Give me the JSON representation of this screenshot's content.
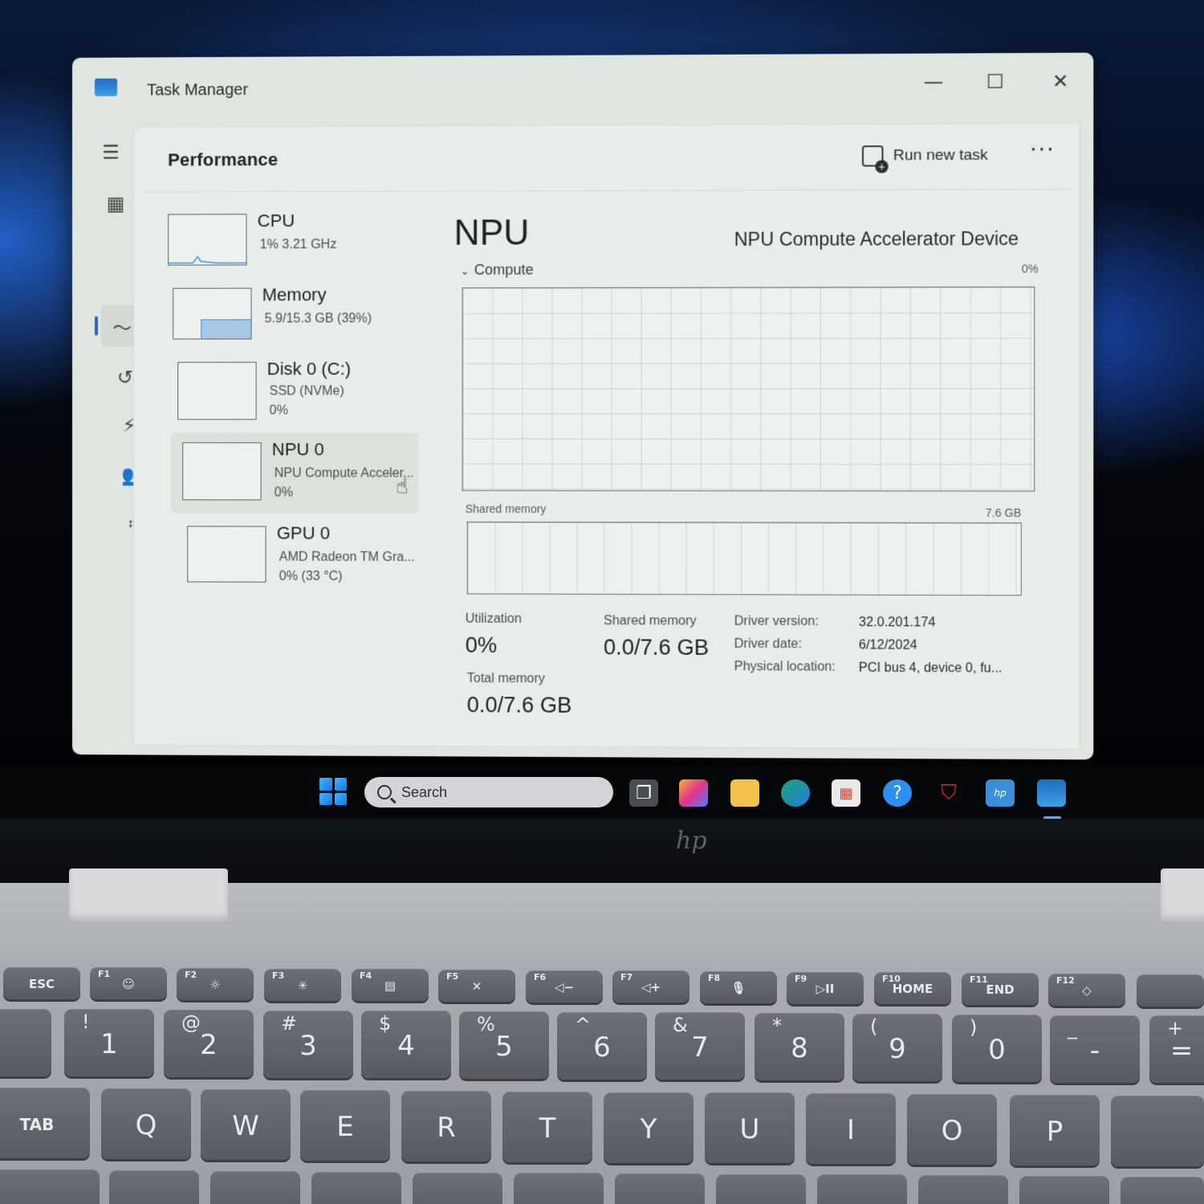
{
  "window": {
    "app_title": "Task Manager",
    "minimize": "—",
    "maximize": "☐",
    "close": "✕"
  },
  "header": {
    "page_title": "Performance",
    "run_new_task": "Run new task",
    "more": "···"
  },
  "nav_rail": {
    "items": [
      {
        "icon": "hamburger-menu-icon",
        "glyph": "☰"
      },
      {
        "icon": "processes-icon",
        "glyph": "▦"
      },
      {
        "icon": "performance-icon",
        "glyph": "〜"
      },
      {
        "icon": "app-history-icon",
        "glyph": "↺"
      },
      {
        "icon": "startup-apps-icon",
        "glyph": "⚡"
      },
      {
        "icon": "users-icon",
        "glyph": "👥"
      },
      {
        "icon": "details-icon",
        "glyph": "≔"
      },
      {
        "icon": "services-icon",
        "glyph": "⚙"
      },
      {
        "icon": "settings-icon",
        "glyph": "⚙"
      }
    ]
  },
  "devices": [
    {
      "name": "CPU",
      "line1": "1%  3.21 GHz",
      "line2": ""
    },
    {
      "name": "Memory",
      "line1": "5.9/15.3 GB (39%)",
      "line2": ""
    },
    {
      "name": "Disk 0 (C:)",
      "line1": "SSD (NVMe)",
      "line2": "0%"
    },
    {
      "name": "NPU 0",
      "line1": "NPU Compute Acceler...",
      "line2": "0%"
    },
    {
      "name": "GPU 0",
      "line1": "AMD Radeon TM Gra...",
      "line2": "0%  (33 °C)"
    }
  ],
  "main": {
    "title": "NPU",
    "device_name": "NPU Compute Accelerator Device",
    "compute_label": "Compute",
    "compute_max": "0%",
    "compute_utilization_percent": 0,
    "shared_memory_label": "Shared memory",
    "shared_memory_max": "7.6 GB",
    "stats": {
      "utilization_label": "Utilization",
      "utilization_value": "0%",
      "shared_memory_label": "Shared memory",
      "shared_memory_value": "0.0/7.6 GB",
      "total_memory_label": "Total memory",
      "total_memory_value": "0.0/7.6 GB"
    },
    "info": {
      "driver_version_label": "Driver version:",
      "driver_version": "32.0.201.174",
      "driver_date_label": "Driver date:",
      "driver_date": "6/12/2024",
      "physical_location_label": "Physical location:",
      "physical_location": "PCI bus 4, device 0, fu..."
    }
  },
  "taskbar": {
    "search_placeholder": "Search",
    "apps": [
      "task-view-icon",
      "copilot-icon",
      "file-explorer-icon",
      "edge-icon",
      "microsoft-store-icon",
      "help-icon",
      "mcafee-icon",
      "myhp-icon",
      "task-manager-icon"
    ]
  },
  "keyboard": {
    "fn_row": [
      {
        "fn": "ESC",
        "label": ""
      },
      {
        "fn": "F1",
        "label": "☺"
      },
      {
        "fn": "F2",
        "label": "☼"
      },
      {
        "fn": "F3",
        "label": "✳"
      },
      {
        "fn": "F4",
        "label": "▤"
      },
      {
        "fn": "F5",
        "label": "✕"
      },
      {
        "fn": "F6",
        "label": "◁−"
      },
      {
        "fn": "F7",
        "label": "◁+"
      },
      {
        "fn": "F8",
        "label": "🎙"
      },
      {
        "fn": "F9",
        "label": "▷II"
      },
      {
        "fn": "F10",
        "label": "HOME"
      },
      {
        "fn": "F11",
        "label": "END"
      },
      {
        "fn": "F12",
        "label": "◇"
      }
    ],
    "number_row": [
      {
        "main": "1",
        "sec": "!"
      },
      {
        "main": "2",
        "sec": "@"
      },
      {
        "main": "3",
        "sec": "#"
      },
      {
        "main": "4",
        "sec": "$"
      },
      {
        "main": "5",
        "sec": "%"
      },
      {
        "main": "6",
        "sec": "^"
      },
      {
        "main": "7",
        "sec": "&"
      },
      {
        "main": "8",
        "sec": "*"
      },
      {
        "main": "9",
        "sec": "("
      },
      {
        "main": "0",
        "sec": ")"
      },
      {
        "main": "-",
        "sec": "_"
      },
      {
        "main": "=",
        "sec": "+"
      }
    ],
    "letter_row": [
      "Q",
      "W",
      "E",
      "R",
      "T",
      "Y",
      "U",
      "I",
      "O",
      "P"
    ],
    "tab_label": "TAB"
  }
}
